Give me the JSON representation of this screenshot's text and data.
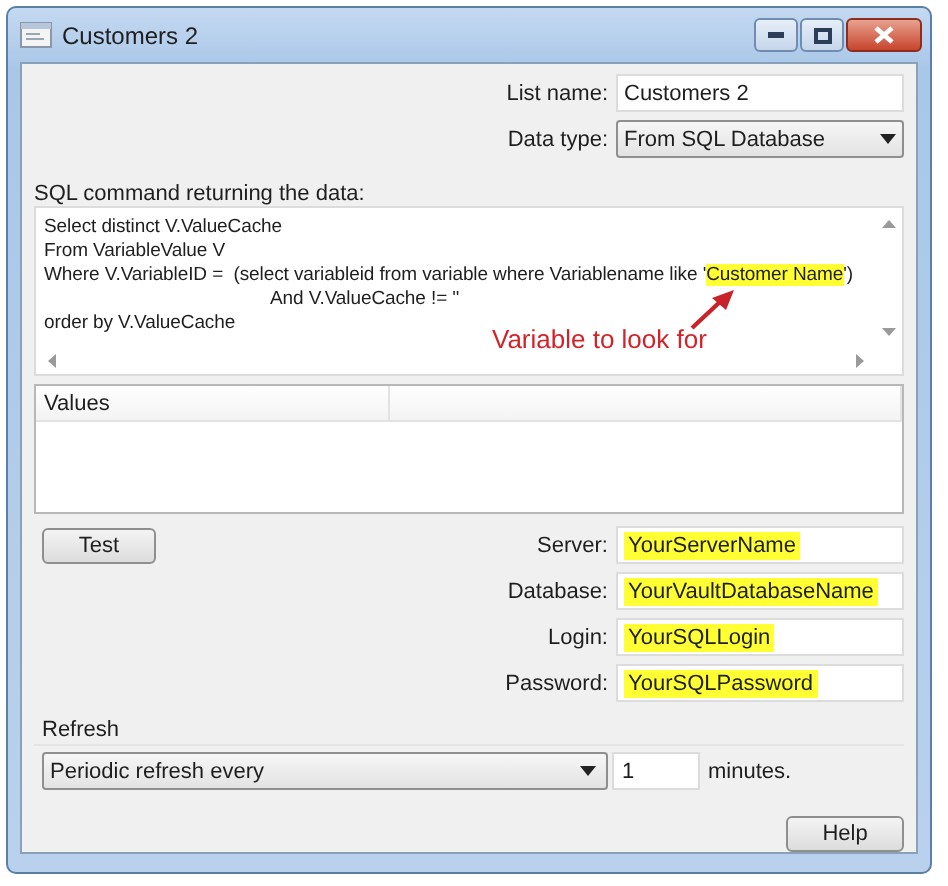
{
  "window": {
    "title": "Customers 2"
  },
  "list_name": {
    "label": "List name:",
    "value": "Customers 2",
    "highlighted": false
  },
  "data_type": {
    "label": "Data type:",
    "value": "From SQL Database"
  },
  "sql": {
    "label": "SQL command returning the data:",
    "lines": [
      {
        "kind": "plain",
        "segments": [
          {
            "text": "Select distinct V.ValueCache",
            "highlighted": false
          }
        ]
      },
      {
        "kind": "plain",
        "segments": [
          {
            "text": "From VariableValue V",
            "highlighted": false
          }
        ]
      },
      {
        "kind": "plain",
        "segments": [
          {
            "text": "Where V.VariableID =  (select variableid from variable where Variablename like '",
            "highlighted": false
          },
          {
            "text": "Customer Name",
            "highlighted": true
          },
          {
            "text": "')",
            "highlighted": false
          }
        ]
      },
      {
        "kind": "continuation",
        "segments": [
          {
            "text": "And V.ValueCache != ''",
            "highlighted": false
          }
        ]
      },
      {
        "kind": "plain",
        "segments": [
          {
            "text": "order by V.ValueCache",
            "highlighted": false
          }
        ]
      }
    ]
  },
  "annotation": {
    "text": "Variable to look for"
  },
  "values_table": {
    "columns": [
      "Values"
    ]
  },
  "test_button": "Test",
  "connection": [
    {
      "label": "Server:",
      "value": "YourServerName",
      "highlighted": true
    },
    {
      "label": "Database:",
      "value": "YourVaultDatabaseName",
      "highlighted": true
    },
    {
      "label": "Login:",
      "value": "YourSQLLogin",
      "highlighted": true
    },
    {
      "label": "Password:",
      "value": "YourSQLPassword",
      "highlighted": true
    }
  ],
  "refresh": {
    "label": "Refresh",
    "mode": "Periodic refresh every",
    "interval": "1",
    "unit": "minutes."
  },
  "buttons": [
    "Help"
  ]
}
